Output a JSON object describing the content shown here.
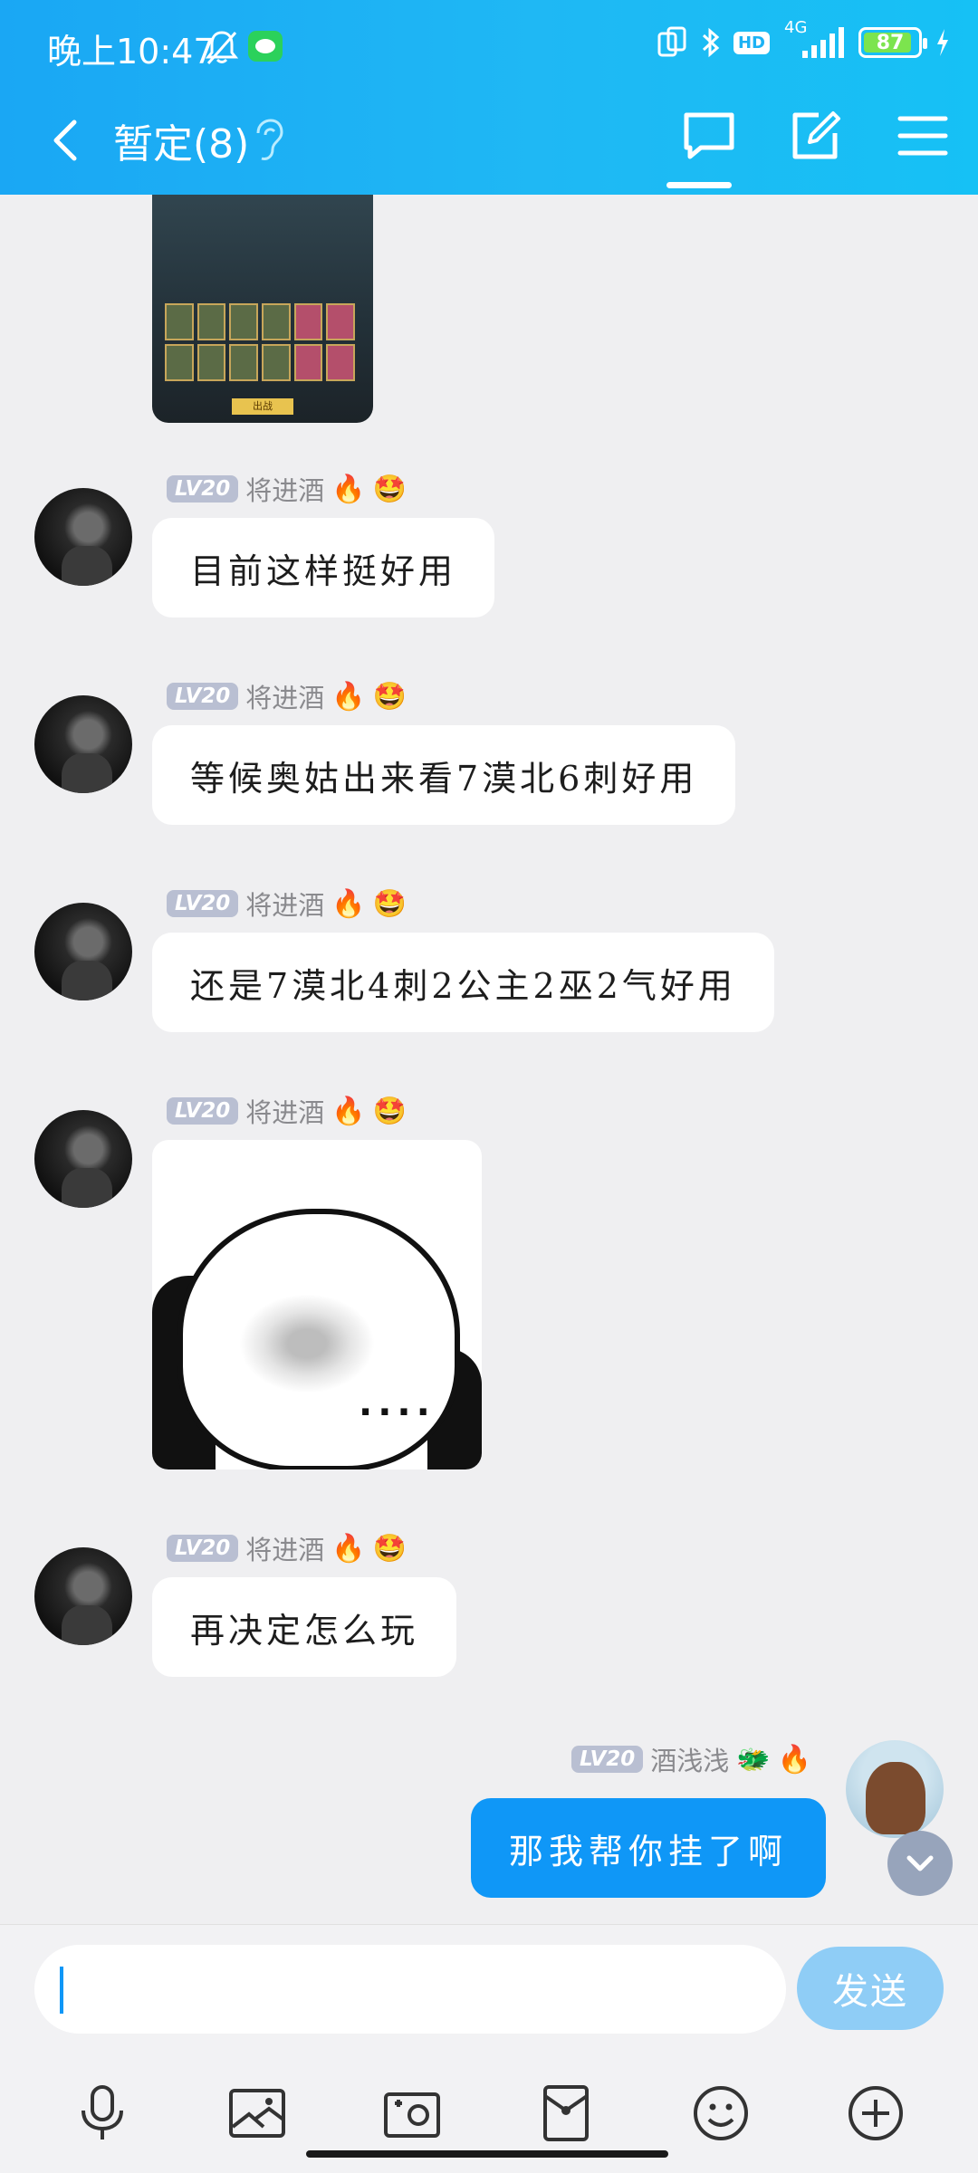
{
  "status_bar": {
    "time": "晚上10:47",
    "network": "4G",
    "hd": "HD",
    "battery": "87"
  },
  "header": {
    "title": "暂定(8)",
    "colors": {
      "gradient_start": "#1aa7f4",
      "gradient_end": "#16c1f5"
    },
    "icons": [
      "back-icon",
      "ear-icon",
      "chat-bubble-icon",
      "edit-note-icon",
      "menu-icon"
    ]
  },
  "messages": [
    {
      "type": "image",
      "sender": "将进酒",
      "level": "LV20",
      "image_desc_icon": "game-screenshot-icon",
      "image_button": "出战"
    },
    {
      "type": "text",
      "sender": "将进酒",
      "level": "LV20",
      "text": "目前这样挺好用"
    },
    {
      "type": "text",
      "sender": "将进酒",
      "level": "LV20",
      "text": "等候奥姑出来看7漠北6刺好用"
    },
    {
      "type": "text",
      "sender": "将进酒",
      "level": "LV20",
      "text": "还是7漠北4刺2公主2巫2气好用"
    },
    {
      "type": "sticker",
      "sender": "将进酒",
      "level": "LV20",
      "sticker_text": "...."
    },
    {
      "type": "text",
      "sender": "将进酒",
      "level": "LV20",
      "text": "再决定怎么玩"
    }
  ],
  "my_message": {
    "sender": "酒浅浅",
    "level": "LV20",
    "text": "那我帮你挂了啊",
    "bubble_color": "#0f97f7"
  },
  "badges": {
    "fire": "🔥",
    "smile": "🤩",
    "dragon": "🐲"
  },
  "input": {
    "placeholder": "",
    "send_label": "发送"
  },
  "toolbar_icons": [
    "microphone-icon",
    "picture-icon",
    "camera-icon",
    "red-packet-icon",
    "emoji-icon",
    "plus-icon"
  ]
}
